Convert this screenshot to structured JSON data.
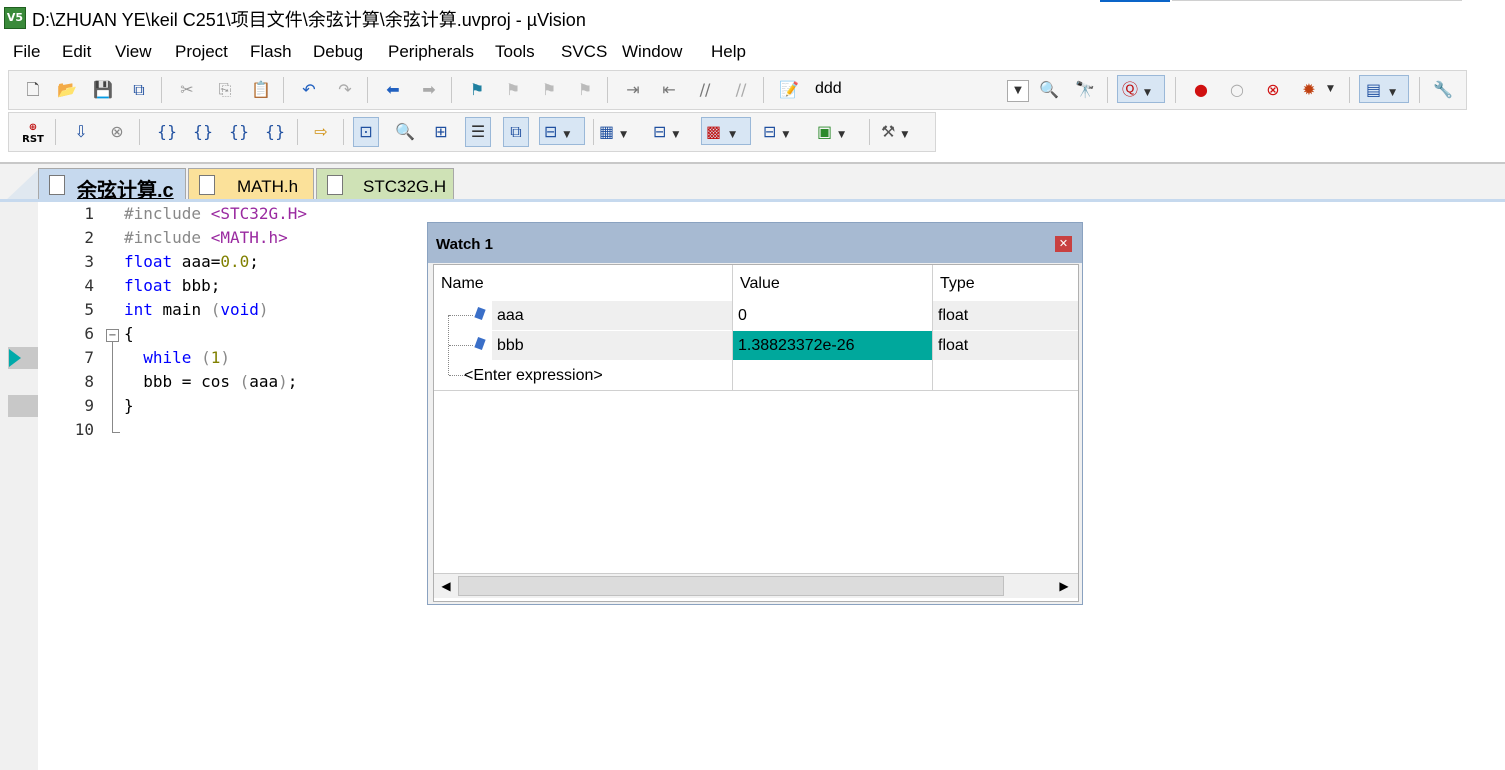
{
  "window": {
    "title": "D:\\ZHUAN YE\\keil C251\\项目文件\\余弦计算\\余弦计算.uvproj - µVision",
    "app_icon_label": "V5"
  },
  "menu": [
    "File",
    "Edit",
    "View",
    "Project",
    "Flash",
    "Debug",
    "Peripherals",
    "Tools",
    "SVCS",
    "Window",
    "Help"
  ],
  "toolbar": {
    "target_name": "ddd"
  },
  "toolbar2": {
    "reset_label": "RST"
  },
  "tabs": [
    {
      "label": "余弦计算.c",
      "active": true,
      "color": "#c6d9ee"
    },
    {
      "label": "MATH.h",
      "active": false,
      "color": "#fbe19a"
    },
    {
      "label": "STC32G.H",
      "active": false,
      "color": "#cfe2b6"
    }
  ],
  "editor": {
    "lines": [
      {
        "num": "1",
        "tokens": [
          {
            "t": "#include ",
            "c": "pp"
          },
          {
            "t": "<STC32G.H>",
            "c": "str"
          }
        ]
      },
      {
        "num": "2",
        "tokens": [
          {
            "t": "#include ",
            "c": "pp"
          },
          {
            "t": "<MATH.h>",
            "c": "str"
          }
        ]
      },
      {
        "num": "3",
        "tokens": [
          {
            "t": "float",
            "c": "kw"
          },
          {
            "t": " aaa=",
            "c": ""
          },
          {
            "t": "0.0",
            "c": "num"
          },
          {
            "t": ";",
            "c": ""
          }
        ]
      },
      {
        "num": "4",
        "tokens": [
          {
            "t": "float",
            "c": "kw"
          },
          {
            "t": " bbb;",
            "c": ""
          }
        ]
      },
      {
        "num": "5",
        "tokens": [
          {
            "t": "int",
            "c": "kw"
          },
          {
            "t": " main ",
            "c": ""
          },
          {
            "t": "(",
            "c": "pp"
          },
          {
            "t": "void",
            "c": "kw"
          },
          {
            "t": ")",
            "c": "pp"
          }
        ]
      },
      {
        "num": "6",
        "tokens": [
          {
            "t": "{",
            "c": ""
          }
        ]
      },
      {
        "num": "7",
        "tokens": [
          {
            "t": "  ",
            "c": ""
          },
          {
            "t": "while",
            "c": "kw"
          },
          {
            "t": " ",
            "c": ""
          },
          {
            "t": "(",
            "c": "pp"
          },
          {
            "t": "1",
            "c": "num"
          },
          {
            "t": ")",
            "c": "pp"
          }
        ]
      },
      {
        "num": "8",
        "tokens": [
          {
            "t": "  bbb = cos ",
            "c": ""
          },
          {
            "t": "(",
            "c": "pp"
          },
          {
            "t": "aaa",
            "c": ""
          },
          {
            "t": ")",
            "c": "pp"
          },
          {
            "t": ";",
            "c": ""
          }
        ]
      },
      {
        "num": "9",
        "tokens": [
          {
            "t": "}",
            "c": ""
          }
        ]
      },
      {
        "num": "10",
        "tokens": []
      }
    ],
    "current_line": "7"
  },
  "watch": {
    "title": "Watch 1",
    "columns": [
      "Name",
      "Value",
      "Type"
    ],
    "rows": [
      {
        "name": "aaa",
        "value": "0",
        "type": "float",
        "highlight": false
      },
      {
        "name": "bbb",
        "value": "1.38823372e-26",
        "type": "float",
        "highlight": true
      }
    ],
    "enter_expression": "<Enter expression>",
    "highlight_color": "#00a89c"
  }
}
